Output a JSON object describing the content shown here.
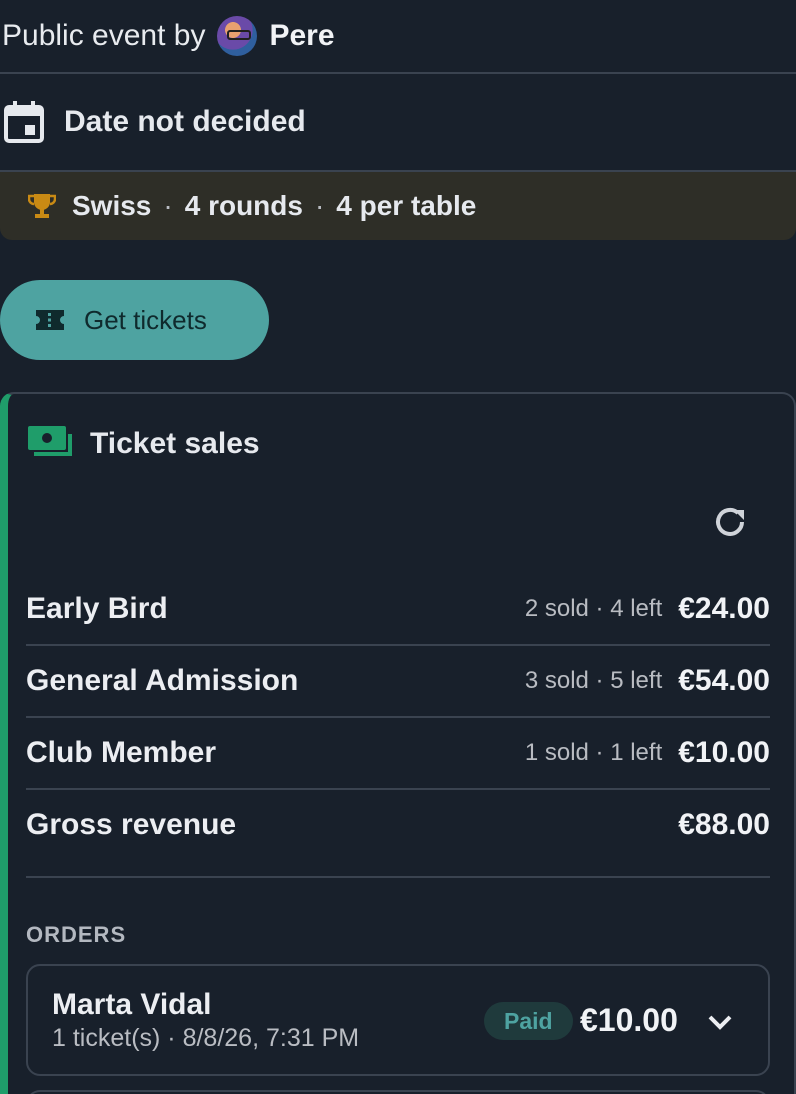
{
  "header": {
    "organizer_prefix": "Public event by",
    "organizer_name": "Pere"
  },
  "event": {
    "date_text": "Date not decided",
    "format": {
      "type": "Swiss",
      "rounds": "4 rounds",
      "per_table": "4 per table",
      "separator": "·"
    }
  },
  "actions": {
    "get_tickets_label": "Get tickets"
  },
  "sales": {
    "title": "Ticket sales",
    "tickets": [
      {
        "name": "Early Bird",
        "meta": "2 sold · 4 left",
        "price": "€24.00"
      },
      {
        "name": "General Admission",
        "meta": "3 sold · 5 left",
        "price": "€54.00"
      },
      {
        "name": "Club Member",
        "meta": "1 sold · 1 left",
        "price": "€10.00"
      }
    ],
    "gross_revenue_label": "Gross revenue",
    "gross_revenue_value": "€88.00",
    "orders_heading": "ORDERS",
    "orders": [
      {
        "name": "Marta Vidal",
        "details": "1 ticket(s) · 8/8/26, 7:31 PM",
        "status": "Paid",
        "amount": "€10.00"
      }
    ]
  },
  "colors": {
    "background": "#18202b",
    "accent_teal": "#4ea3a1",
    "accent_green": "#1f9d6a",
    "trophy_gold": "#c98a14",
    "format_bar": "#2e2e27"
  },
  "icons": {
    "calendar": "calendar-icon",
    "trophy": "trophy-icon",
    "ticket": "ticket-icon",
    "money": "money-icon",
    "refresh": "refresh-icon",
    "chevron": "chevron-down-icon"
  }
}
